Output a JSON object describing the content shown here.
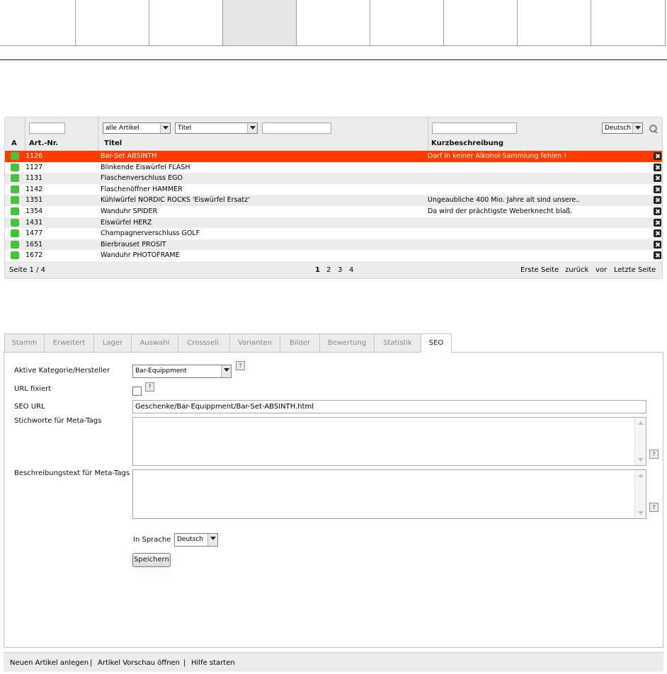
{
  "list": {
    "filters": {
      "article_type": "alle Artikel",
      "search_field": "Titel",
      "language": "Deutsch"
    },
    "columns": {
      "active": "A",
      "artnr": "Art.-Nr.",
      "title": "Titel",
      "short": "Kurzbeschreibung"
    },
    "rows": [
      {
        "nr": "1126",
        "title": "Bar-Set ABSINTH",
        "short": "Darf in keiner Alkohol-Sammlung fehlen !"
      },
      {
        "nr": "1127",
        "title": "Blinkende Eiswürfel FLASH",
        "short": ""
      },
      {
        "nr": "1131",
        "title": "Flaschenverschluss EGO",
        "short": ""
      },
      {
        "nr": "1142",
        "title": "Flaschenöffner HAMMER",
        "short": ""
      },
      {
        "nr": "1351",
        "title": "Kühlwürfel NORDIC ROCKS 'Eiswürfel Ersatz'",
        "short": "Ungeaubliche 400 Mio. Jahre alt sind unsere.."
      },
      {
        "nr": "1354",
        "title": "Wanduhr SPIDER",
        "short": "Da wird der prächtigste Weberknecht blaß."
      },
      {
        "nr": "1431",
        "title": "Eiswürfel HERZ",
        "short": ""
      },
      {
        "nr": "1477",
        "title": "Champagnerverschluss GOLF",
        "short": ""
      },
      {
        "nr": "1651",
        "title": "Bierbrauset PROSIT",
        "short": ""
      },
      {
        "nr": "1672",
        "title": "Wanduhr PHOTOFRAME",
        "short": ""
      }
    ],
    "pager": {
      "page_info": "Seite 1 / 4",
      "pages": [
        "1",
        "2",
        "3",
        "4"
      ],
      "first": "Erste Seite",
      "back": "zurück",
      "next": "vor",
      "last": "Letzte Seite"
    }
  },
  "tabs": [
    "Stamm",
    "Erweitert",
    "Lager",
    "Auswahl",
    "Crosssell.",
    "Varianten",
    "Bilder",
    "Bewertung",
    "Statistik",
    "SEO"
  ],
  "seo": {
    "category_label": "Aktive Kategorie/Hersteller",
    "category_value": "Bar-Equippment",
    "url_fixed_label": "URL fixiert",
    "seo_url_label": "SEO URL",
    "seo_url_value": "Geschenke/Bar-Equippment/Bar-Set-ABSINTH.html",
    "keywords_label": "Stichworte für Meta-Tags",
    "description_label": "Beschreibungstext für Meta-Tags",
    "language_label": "In Sprache",
    "language_value": "Deutsch",
    "save_label": "Speichern",
    "help_glyph": "?"
  },
  "footer": {
    "new_article": "Neuen Artikel anlegen",
    "preview": "Artikel Vorschau öffnen",
    "help": "Hilfe starten",
    "separator": "|"
  },
  "colors": {
    "selected_row": "#ff3b00",
    "active_status": "#43c43b",
    "panel_bg": "#ececec"
  }
}
